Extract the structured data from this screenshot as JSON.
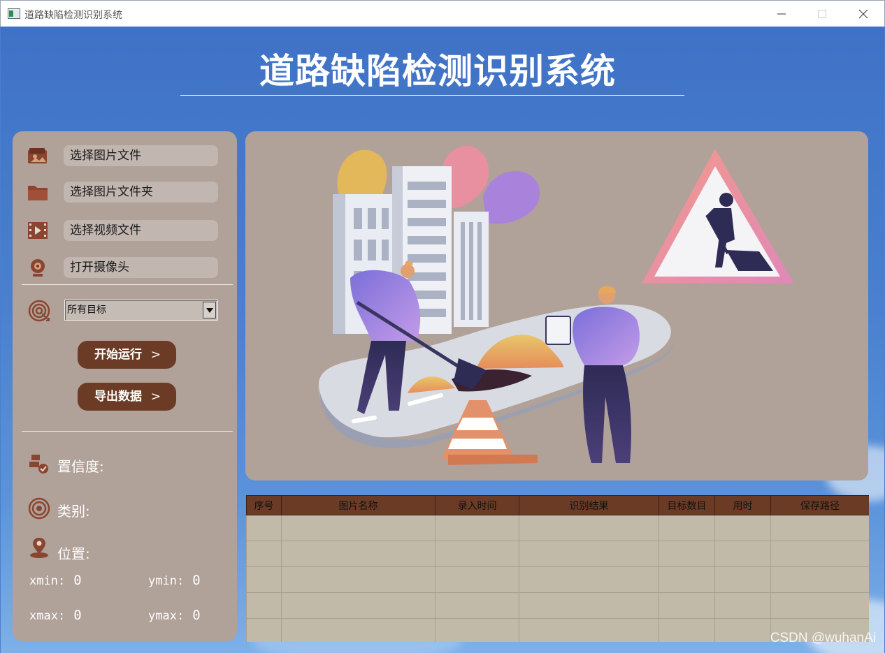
{
  "window": {
    "title": "道路缺陷检测识别系统",
    "controls": [
      "minimize",
      "maximize",
      "close"
    ]
  },
  "header": {
    "title": "道路缺陷检测识别系统"
  },
  "sidebar": {
    "menu": [
      {
        "label": "选择图片文件",
        "icon": "image-file-icon"
      },
      {
        "label": "选择图片文件夹",
        "icon": "folder-icon"
      },
      {
        "label": "选择视频文件",
        "icon": "video-file-icon"
      },
      {
        "label": "打开摄像头",
        "icon": "camera-icon"
      }
    ],
    "target_select": {
      "value": "所有目标",
      "icon": "target-icon"
    },
    "start_button": "开始运行",
    "export_button": "导出数据",
    "chevron": ">",
    "confidence_label": "置信度:",
    "class_label": "类别:",
    "position_label": "位置:",
    "coords": {
      "xmin_label": "xmin:",
      "xmin": "0",
      "ymin_label": "ymin:",
      "ymin": "0",
      "xmax_label": "xmax:",
      "xmax": "0",
      "ymax_label": "ymax:",
      "ymax": "0"
    }
  },
  "illustration": {
    "description_icon": "road-construction-illustration",
    "sign_icon": "men-at-work-sign-icon"
  },
  "table": {
    "headers": [
      "序号",
      "图片名称",
      "录入时间",
      "识别结果",
      "目标数目",
      "用时",
      "保存路径"
    ],
    "rows": [
      [],
      [],
      [],
      [],
      []
    ]
  },
  "watermark": "CSDN @wuhanAi",
  "colors": {
    "accent_brown": "#6b3b25",
    "panel": "#b0a199",
    "background_blue": "#4a80cf"
  }
}
